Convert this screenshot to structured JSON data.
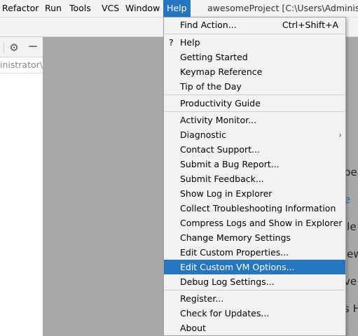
{
  "menubar": {
    "items": [
      "Refactor",
      "Run",
      "Tools",
      "VCS",
      "Window",
      "Help"
    ],
    "title": "awesomeProject [C:\\Users\\Administra"
  },
  "left_panel": {
    "path_text": "inistrator\\g"
  },
  "editor_fragments": [
    "pe",
    "e",
    "ile",
    "iew",
    "ve",
    "s H"
  ],
  "help_menu": {
    "find_action": {
      "label": "Find Action...",
      "shortcut": "Ctrl+Shift+A"
    },
    "help": {
      "prefix": "?",
      "label": "Help"
    },
    "getting_started": "Getting Started",
    "keymap_reference": "Keymap Reference",
    "tip_of_the_day": "Tip of the Day",
    "productivity_guide": "Productivity Guide",
    "activity_monitor": "Activity Monitor...",
    "diagnostic": {
      "label": "Diagnostic",
      "arrow": "›"
    },
    "contact_support": "Contact Support...",
    "submit_bug_report": "Submit a Bug Report...",
    "submit_feedback": "Submit Feedback...",
    "show_log": "Show Log in Explorer",
    "collect_troubleshooting": "Collect Troubleshooting Information",
    "compress_logs": "Compress Logs and Show in Explorer",
    "change_memory": "Change Memory Settings",
    "edit_custom_properties": "Edit Custom Properties...",
    "edit_custom_vm_options": "Edit Custom VM Options...",
    "debug_log_settings": "Debug Log Settings...",
    "register": "Register...",
    "check_updates": "Check for Updates...",
    "about": "About"
  },
  "colors": {
    "selection": "#2675bf",
    "menu_bg": "#f2f2f2",
    "editor_bg": "#a8a8a8"
  }
}
